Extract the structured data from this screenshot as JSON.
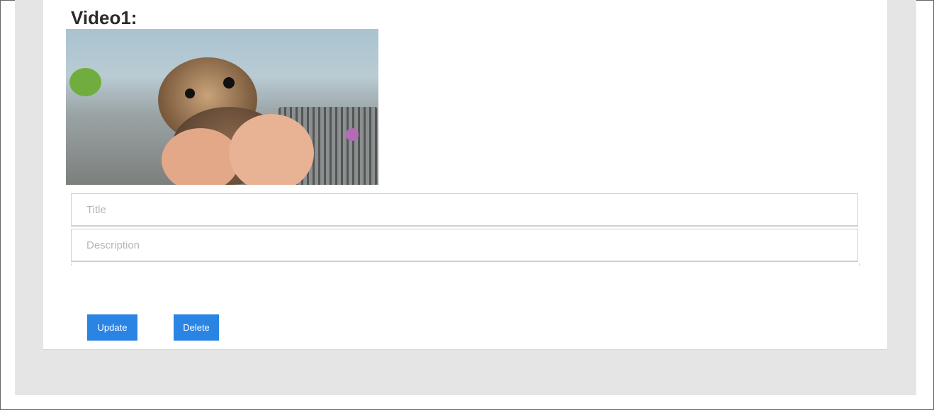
{
  "video": {
    "heading": "Video1:",
    "thumbnail_alt": "Kitten held in hands",
    "title_placeholder": "Title",
    "description_placeholder": "Description",
    "update_label": "Update",
    "delete_label": "Delete"
  },
  "colors": {
    "button": "#2a84e4",
    "background": "#e5e5e5"
  }
}
